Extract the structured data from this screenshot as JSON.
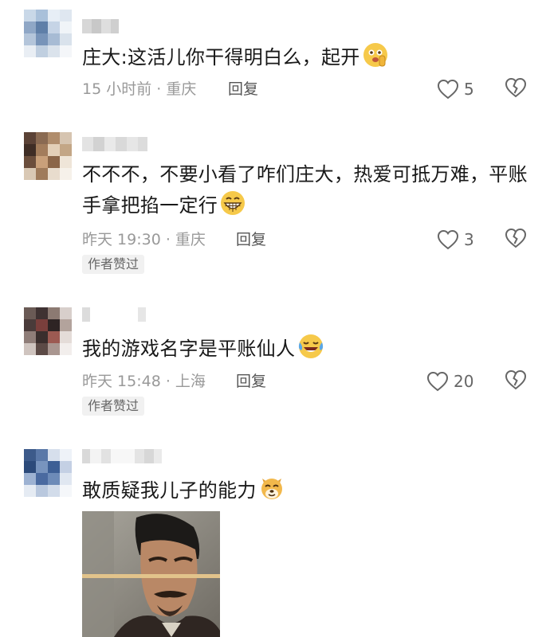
{
  "comments": [
    {
      "text": "庄大:这活儿你干得明白么，起开",
      "emoji": "shushing-face-emoji",
      "meta": "15 小时前 · 重庆",
      "reply_label": "回复",
      "likes": "5",
      "author_liked_tag": ""
    },
    {
      "text": "不不不，不要小看了咋们庄大，热爱可抵万难，平账手拿把掐一定行",
      "emoji": "grinning-face-emoji",
      "meta": "昨天 19:30 · 重庆",
      "reply_label": "回复",
      "likes": "3",
      "author_liked_tag": "作者赞过"
    },
    {
      "text": "我的游戏名字是平账仙人",
      "emoji": "tears-of-joy-emoji",
      "meta": "昨天 15:48 · 上海",
      "reply_label": "回复",
      "likes": "20",
      "author_liked_tag": "作者赞过"
    },
    {
      "text": "敢质疑我儿子的能力",
      "emoji": "dog-face-emoji",
      "meta": "",
      "reply_label": "",
      "likes": "",
      "author_liked_tag": ""
    }
  ],
  "icons": {
    "like": "heart-outline-icon",
    "dislike": "broken-heart-icon"
  },
  "colors": {
    "text": "#191919",
    "meta": "#999999",
    "icon": "#666666"
  }
}
